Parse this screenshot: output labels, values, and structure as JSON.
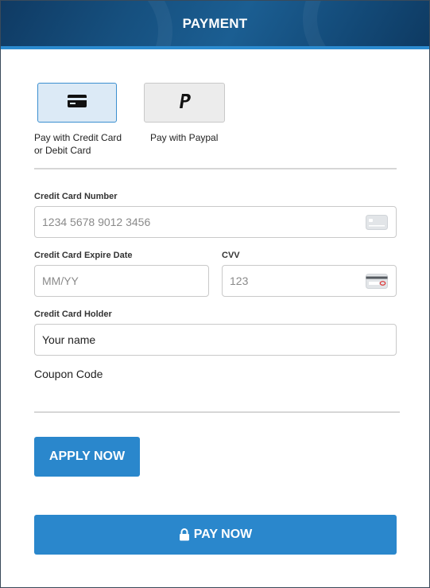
{
  "header": {
    "title": "PAYMENT"
  },
  "payment_methods": [
    {
      "label_line1": "Pay with Credit Card",
      "label_line2": "or Debit Card",
      "icon": "credit-card-icon",
      "selected": true
    },
    {
      "label_line1": "Pay with Paypal",
      "label_line2": "",
      "icon": "paypal-icon",
      "selected": false
    }
  ],
  "form": {
    "card_number": {
      "label": "Credit Card Number",
      "placeholder": "1234 5678 9012 3456",
      "icon": "card-icon"
    },
    "expire_date": {
      "label": "Credit Card Expire Date",
      "placeholder": "MM/YY"
    },
    "cvv": {
      "label": "CVV",
      "placeholder": "123",
      "icon": "cvv-card-icon"
    },
    "holder": {
      "label": "Credit Card Holder",
      "value": "Your name"
    },
    "coupon": {
      "label": "Coupon Code"
    }
  },
  "buttons": {
    "apply": "APPLY NOW",
    "pay": "PAY NOW",
    "pay_icon": "lock-icon"
  },
  "colors": {
    "header_bg": "#16507f",
    "accent": "#2a87cc",
    "selected_bg": "#dceaf6"
  }
}
